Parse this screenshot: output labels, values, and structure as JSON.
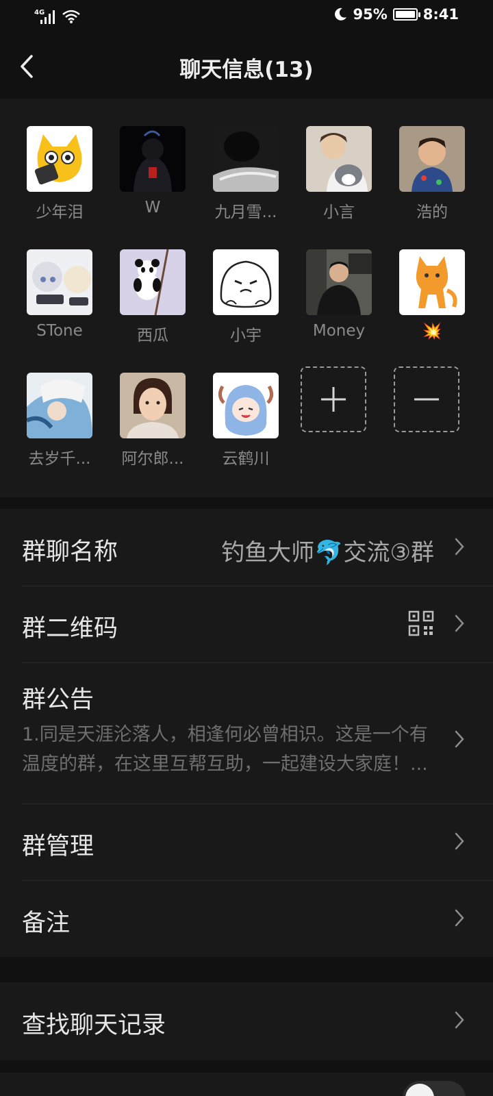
{
  "status_bar": {
    "network": "4G",
    "battery": "95%",
    "time": "8:41"
  },
  "header": {
    "title": "聊天信息(13)",
    "back_icon": "chevron-left-icon"
  },
  "members": [
    {
      "name": "少年泪"
    },
    {
      "name": "W"
    },
    {
      "name": "九月雪..."
    },
    {
      "name": "小言"
    },
    {
      "name": "浩的"
    },
    {
      "name": "STone"
    },
    {
      "name": "西瓜"
    },
    {
      "name": "小宇"
    },
    {
      "name": "Money"
    },
    {
      "name": "💥"
    },
    {
      "name": "去岁千..."
    },
    {
      "name": "阿尔郎..."
    },
    {
      "name": "云鹤川"
    }
  ],
  "member_controls": {
    "add_icon": "plus-icon",
    "remove_icon": "minus-icon"
  },
  "settings": {
    "group_name_label": "群聊名称",
    "group_name_value": "钓鱼大师🐬交流③群",
    "qr_label": "群二维码",
    "qr_icon": "qr-code-icon",
    "notice_label": "群公告",
    "notice_text": "1.同是天涯沦落人，相逢何必曾相识。这是一个有温度的群，在这里互帮互助，一起建设大家庭！...",
    "manage_label": "群管理",
    "remark_label": "备注",
    "search_label": "查找聊天记录"
  },
  "colors": {
    "background": "#111111",
    "surface": "#191919",
    "text_primary": "#e6e6e6",
    "text_secondary": "#8a8a8a"
  }
}
